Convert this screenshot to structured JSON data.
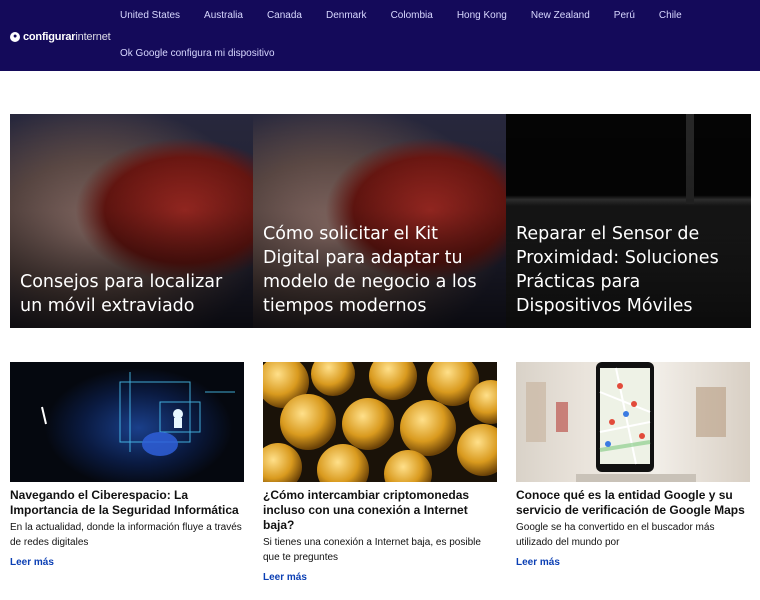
{
  "brand": {
    "name_a": "configurar",
    "name_b": "internet"
  },
  "nav": {
    "row1": [
      "United States",
      "Australia",
      "Canada",
      "Denmark",
      "Colombia",
      "Hong Kong",
      "New Zealand",
      "Perú",
      "Chile"
    ],
    "row2": [
      "Ok Google configura mi dispositivo"
    ]
  },
  "featured": [
    {
      "title": "Consejos para localizar un móvil extraviado"
    },
    {
      "title": "Cómo solicitar el Kit Digital para adaptar tu modelo de negocio a los tiempos modernos"
    },
    {
      "title": "Reparar el Sensor de Proximidad: Soluciones Prácticas para Dispositivos Móviles"
    }
  ],
  "articles": [
    {
      "title": "Navegando el Ciberespacio: La Importancia de la Seguridad Informática",
      "excerpt": "En la actualidad, donde la información fluye a través de redes digitales",
      "more": "Leer más"
    },
    {
      "title": "¿Cómo intercambiar criptomonedas incluso con una conexión a Internet baja?",
      "excerpt": "Si tienes una conexión a Internet baja, es posible que te preguntes",
      "more": "Leer más"
    },
    {
      "title": "Conoce qué es la entidad Google y su servicio de verificación de Google Maps",
      "excerpt": "Google se ha convertido en el buscador más utilizado del mundo por",
      "more": "Leer más"
    }
  ],
  "colors": {
    "header_bg": "#140a5a",
    "link": "#0b3fb4"
  }
}
